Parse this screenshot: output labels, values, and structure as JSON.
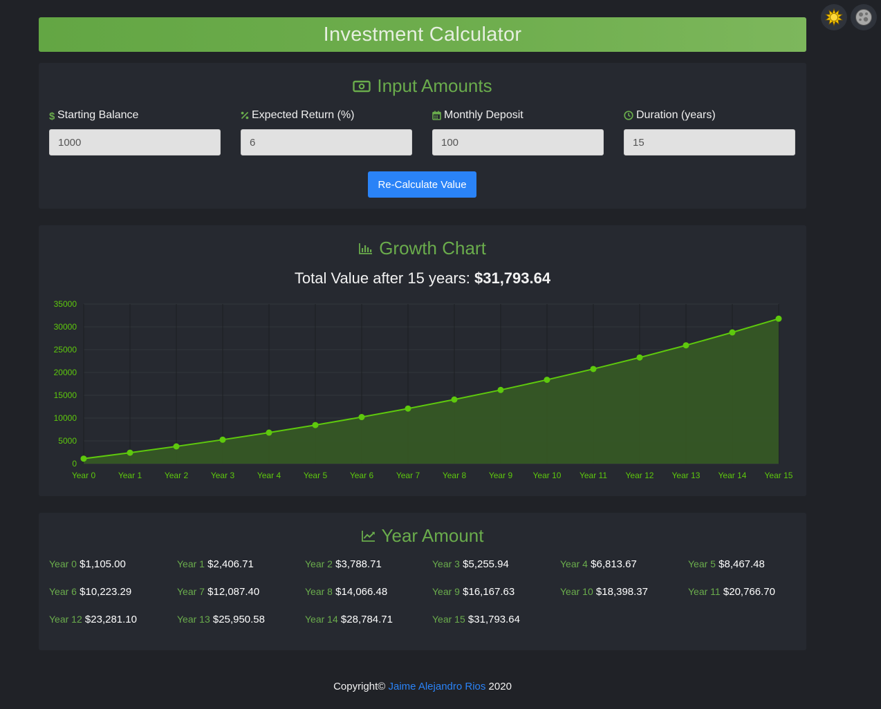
{
  "header": {
    "title": "Investment Calculator"
  },
  "theme": {
    "light_icon": "sun-icon",
    "dark_icon": "moon-icon"
  },
  "inputs": {
    "title": "Input Amounts",
    "title_icon": "money-bill-icon",
    "fields": [
      {
        "label": "Starting Balance",
        "icon": "dollar-icon",
        "value": "1000"
      },
      {
        "label": "Expected Return (%)",
        "icon": "percent-icon",
        "value": "6"
      },
      {
        "label": "Monthly Deposit",
        "icon": "calendar-icon",
        "value": "100"
      },
      {
        "label": "Duration (years)",
        "icon": "clock-icon",
        "value": "15"
      }
    ],
    "button_label": "Re-Calculate Value"
  },
  "growth": {
    "title": "Growth Chart",
    "title_icon": "bar-chart-icon",
    "total_prefix": "Total Value after 15 years: ",
    "total_value": "$31,793.64"
  },
  "chart_data": {
    "type": "area",
    "categories": [
      "Year 0",
      "Year 1",
      "Year 2",
      "Year 3",
      "Year 4",
      "Year 5",
      "Year 6",
      "Year 7",
      "Year 8",
      "Year 9",
      "Year 10",
      "Year 11",
      "Year 12",
      "Year 13",
      "Year 14",
      "Year 15"
    ],
    "values": [
      1105.0,
      2406.71,
      3788.71,
      5255.94,
      6813.67,
      8467.48,
      10223.29,
      12087.4,
      14066.48,
      16167.63,
      18398.37,
      20766.7,
      23281.1,
      25950.58,
      28784.71,
      31793.64
    ],
    "yticks": [
      0,
      5000,
      10000,
      15000,
      20000,
      25000,
      30000,
      35000
    ],
    "ylim": [
      0,
      35000
    ],
    "grid": true,
    "line_color": "#5ec90d",
    "fill_color": "#355725"
  },
  "years": {
    "title": "Year Amount",
    "title_icon": "line-chart-icon",
    "items": [
      {
        "label": "Year 0",
        "value": "$1,105.00"
      },
      {
        "label": "Year 1",
        "value": "$2,406.71"
      },
      {
        "label": "Year 2",
        "value": "$3,788.71"
      },
      {
        "label": "Year 3",
        "value": "$5,255.94"
      },
      {
        "label": "Year 4",
        "value": "$6,813.67"
      },
      {
        "label": "Year 5",
        "value": "$8,467.48"
      },
      {
        "label": "Year 6",
        "value": "$10,223.29"
      },
      {
        "label": "Year 7",
        "value": "$12,087.40"
      },
      {
        "label": "Year 8",
        "value": "$14,066.48"
      },
      {
        "label": "Year 9",
        "value": "$16,167.63"
      },
      {
        "label": "Year 10",
        "value": "$18,398.37"
      },
      {
        "label": "Year 11",
        "value": "$20,766.70"
      },
      {
        "label": "Year 12",
        "value": "$23,281.10"
      },
      {
        "label": "Year 13",
        "value": "$25,950.58"
      },
      {
        "label": "Year 14",
        "value": "$28,784.71"
      },
      {
        "label": "Year 15",
        "value": "$31,793.64"
      }
    ]
  },
  "footer": {
    "prefix": "Copyright© ",
    "author": "Jaime Alejandro Rios",
    "suffix": " 2020"
  },
  "colors": {
    "accent": "#6aac4c",
    "button": "#2a83f7",
    "background": "#202227",
    "card": "#262930"
  }
}
